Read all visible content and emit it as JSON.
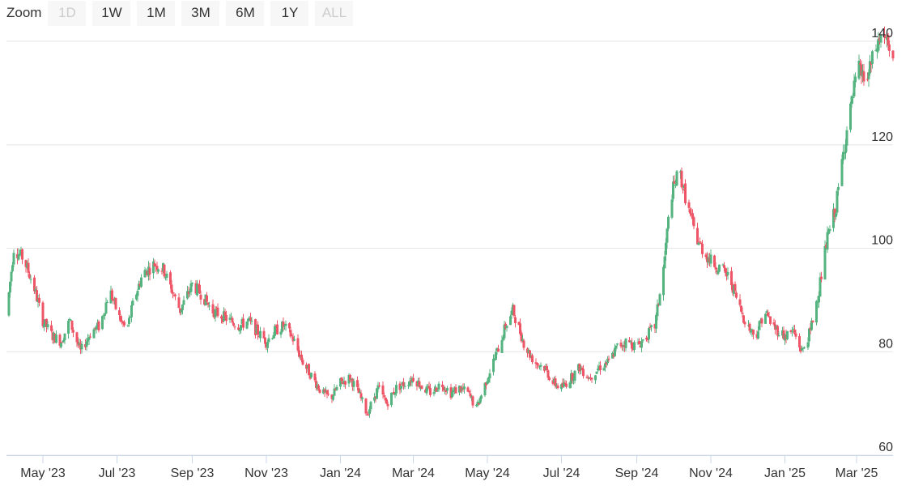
{
  "zoom": {
    "label": "Zoom",
    "buttons": [
      {
        "label": "1D",
        "disabled": true
      },
      {
        "label": "1W",
        "disabled": false
      },
      {
        "label": "1M",
        "disabled": false
      },
      {
        "label": "3M",
        "disabled": false
      },
      {
        "label": "6M",
        "disabled": false
      },
      {
        "label": "1Y",
        "disabled": false
      },
      {
        "label": "ALL",
        "disabled": true
      }
    ]
  },
  "colors": {
    "up": "#55b37f",
    "down": "#ee5566",
    "grid": "#e6e6e6",
    "axis": "#ccd6eb"
  },
  "chart_data": {
    "type": "candlestick",
    "title": "",
    "xlabel": "",
    "ylabel": "",
    "ylim": [
      60,
      140
    ],
    "y_ticks": [
      "60",
      "80",
      "100",
      "120",
      "140"
    ],
    "x_ticks": [
      "May '23",
      "Jul '23",
      "Sep '23",
      "Nov '23",
      "Jan '24",
      "Mar '24",
      "May '24",
      "Jul '24",
      "Sep '24",
      "Nov '24",
      "Jan '25",
      "Mar '25"
    ],
    "x_range": [
      "2023-04-01",
      "2025-03-31"
    ],
    "grid": true,
    "series": [
      {
        "values": [
          [
            "2023-04-01",
            87
          ],
          [
            "2023-04-07",
            100
          ],
          [
            "2023-04-15",
            98
          ],
          [
            "2023-04-23",
            93
          ],
          [
            "2023-05-01",
            86
          ],
          [
            "2023-05-09",
            83
          ],
          [
            "2023-05-16",
            82
          ],
          [
            "2023-05-23",
            86
          ],
          [
            "2023-06-01",
            80
          ],
          [
            "2023-06-10",
            84
          ],
          [
            "2023-06-17",
            85
          ],
          [
            "2023-06-25",
            92
          ],
          [
            "2023-07-02",
            87
          ],
          [
            "2023-07-09",
            84
          ],
          [
            "2023-07-15",
            90
          ],
          [
            "2023-07-22",
            95
          ],
          [
            "2023-08-01",
            97
          ],
          [
            "2023-08-08",
            96
          ],
          [
            "2023-08-15",
            92
          ],
          [
            "2023-08-22",
            88
          ],
          [
            "2023-09-01",
            93
          ],
          [
            "2023-09-09",
            91
          ],
          [
            "2023-09-17",
            88
          ],
          [
            "2023-09-25",
            87
          ],
          [
            "2023-10-02",
            86
          ],
          [
            "2023-10-10",
            85
          ],
          [
            "2023-10-17",
            86
          ],
          [
            "2023-10-24",
            84
          ],
          [
            "2023-11-01",
            82
          ],
          [
            "2023-11-08",
            84
          ],
          [
            "2023-11-15",
            85
          ],
          [
            "2023-11-22",
            83
          ],
          [
            "2023-12-01",
            78
          ],
          [
            "2023-12-09",
            75
          ],
          [
            "2023-12-17",
            72
          ],
          [
            "2023-12-24",
            71
          ],
          [
            "2024-01-01",
            74
          ],
          [
            "2024-01-09",
            75
          ],
          [
            "2024-01-16",
            72
          ],
          [
            "2024-01-23",
            68
          ],
          [
            "2024-02-01",
            73
          ],
          [
            "2024-02-08",
            70
          ],
          [
            "2024-02-16",
            73
          ],
          [
            "2024-02-24",
            74
          ],
          [
            "2024-03-01",
            75
          ],
          [
            "2024-03-09",
            73
          ],
          [
            "2024-03-16",
            72
          ],
          [
            "2024-03-24",
            74
          ],
          [
            "2024-04-01",
            72
          ],
          [
            "2024-04-08",
            73
          ],
          [
            "2024-04-15",
            72
          ],
          [
            "2024-04-22",
            69
          ],
          [
            "2024-05-01",
            75
          ],
          [
            "2024-05-09",
            80
          ],
          [
            "2024-05-16",
            85
          ],
          [
            "2024-05-22",
            88
          ],
          [
            "2024-06-01",
            81
          ],
          [
            "2024-06-09",
            78
          ],
          [
            "2024-06-17",
            77
          ],
          [
            "2024-06-24",
            74
          ],
          [
            "2024-07-01",
            73
          ],
          [
            "2024-07-09",
            75
          ],
          [
            "2024-07-16",
            77
          ],
          [
            "2024-07-24",
            75
          ],
          [
            "2024-08-01",
            77
          ],
          [
            "2024-08-09",
            78
          ],
          [
            "2024-08-16",
            81
          ],
          [
            "2024-08-24",
            82
          ],
          [
            "2024-09-01",
            81
          ],
          [
            "2024-09-09",
            83
          ],
          [
            "2024-09-16",
            85
          ],
          [
            "2024-09-23",
            96
          ],
          [
            "2024-09-29",
            110
          ],
          [
            "2024-10-06",
            115
          ],
          [
            "2024-10-13",
            108
          ],
          [
            "2024-10-20",
            102
          ],
          [
            "2024-10-27",
            99
          ],
          [
            "2024-11-03",
            97
          ],
          [
            "2024-11-10",
            96
          ],
          [
            "2024-11-17",
            94
          ],
          [
            "2024-11-24",
            89
          ],
          [
            "2024-12-01",
            85
          ],
          [
            "2024-12-08",
            83
          ],
          [
            "2024-12-15",
            88
          ],
          [
            "2024-12-22",
            85
          ],
          [
            "2025-01-01",
            83
          ],
          [
            "2025-01-08",
            84
          ],
          [
            "2025-01-15",
            80
          ],
          [
            "2025-01-22",
            84
          ],
          [
            "2025-01-29",
            92
          ],
          [
            "2025-02-05",
            102
          ],
          [
            "2025-02-12",
            108
          ],
          [
            "2025-02-19",
            120
          ],
          [
            "2025-02-25",
            128
          ],
          [
            "2025-03-02",
            135
          ],
          [
            "2025-03-09",
            132
          ],
          [
            "2025-03-16",
            138
          ],
          [
            "2025-03-23",
            142
          ],
          [
            "2025-03-31",
            135
          ]
        ]
      }
    ]
  }
}
